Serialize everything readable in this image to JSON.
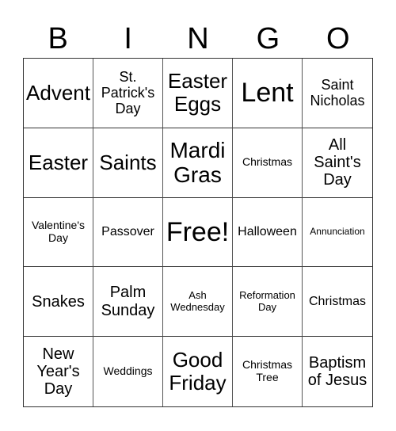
{
  "header": {
    "letters": [
      "B",
      "I",
      "N",
      "G",
      "O"
    ]
  },
  "cells": [
    "Advent",
    "St. Patrick's Day",
    "Easter Eggs",
    "Lent",
    "Saint Nicholas",
    "Easter",
    "Saints",
    "Mardi Gras",
    "Christmas",
    "All Saint's Day",
    "Valentine's Day",
    "Passover",
    "Free!",
    "Halloween",
    "Annunciation",
    "Snakes",
    "Palm Sunday",
    "Ash Wednesday",
    "Reformation Day",
    "Christmas",
    "New Year's Day",
    "Weddings",
    "Good Friday",
    "Christmas Tree",
    "Baptism of Jesus"
  ],
  "free_space": {
    "label": "Free!",
    "row": 3,
    "col": 3
  }
}
